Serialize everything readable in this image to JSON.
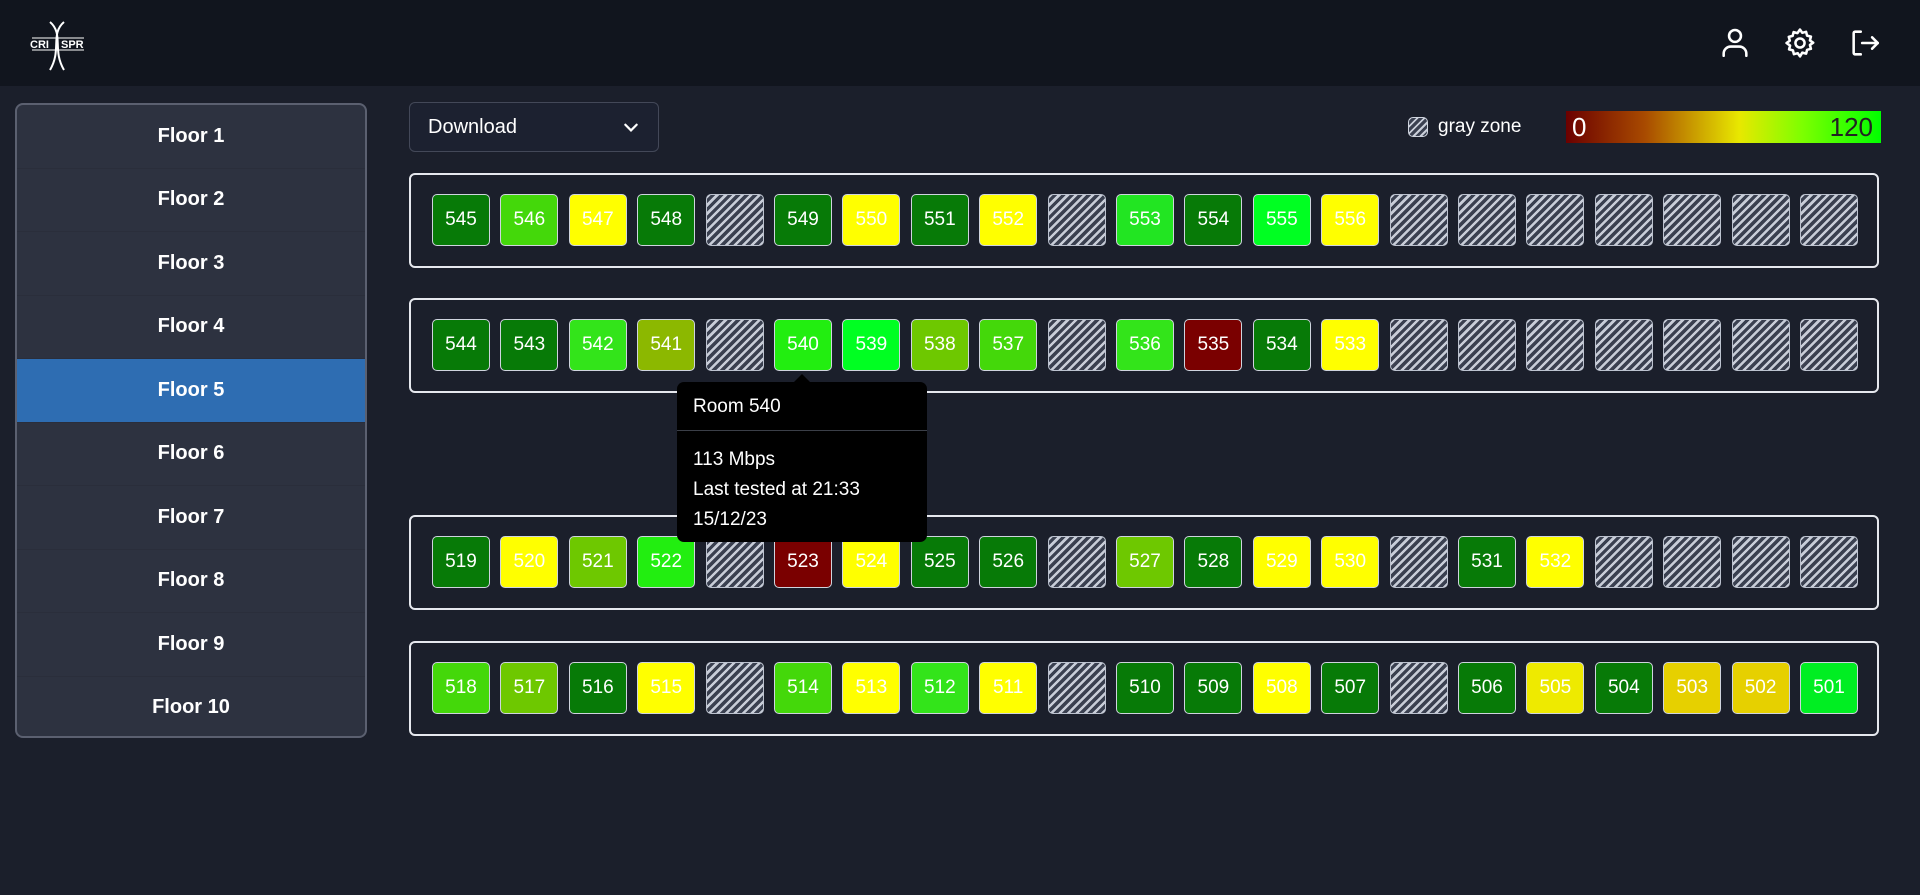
{
  "app": {
    "logo_text": "CRISPR"
  },
  "header": {
    "icons": [
      "user-icon",
      "gear-icon",
      "logout-icon"
    ]
  },
  "sidebar": {
    "items": [
      "Floor 1",
      "Floor 2",
      "Floor 3",
      "Floor 4",
      "Floor 5",
      "Floor 6",
      "Floor 7",
      "Floor 8",
      "Floor 9",
      "Floor 10"
    ],
    "active_index": 4
  },
  "toolbar": {
    "metric_selected": "Download"
  },
  "legend": {
    "gray_label": "gray zone",
    "scale_min": "0",
    "scale_max": "120"
  },
  "colors": {
    "accent": "#2e6db2",
    "scale_low": "#6b0000",
    "scale_high": "#00ff00"
  },
  "rows": [
    [
      {
        "label": "545",
        "color": "#077a07"
      },
      {
        "label": "546",
        "color": "#44d80a"
      },
      {
        "label": "547",
        "color": "#ffff00"
      },
      {
        "label": "548",
        "color": "#077a07"
      },
      {
        "label": "",
        "color": "gray"
      },
      {
        "label": "549",
        "color": "#077a07"
      },
      {
        "label": "550",
        "color": "#ffff00"
      },
      {
        "label": "551",
        "color": "#077a07"
      },
      {
        "label": "552",
        "color": "#ffff00"
      },
      {
        "label": "",
        "color": "gray"
      },
      {
        "label": "553",
        "color": "#22e522"
      },
      {
        "label": "554",
        "color": "#077a07"
      },
      {
        "label": "555",
        "color": "#00ff22"
      },
      {
        "label": "556",
        "color": "#ffff00"
      },
      {
        "label": "",
        "color": "gray"
      },
      {
        "label": "",
        "color": "gray"
      },
      {
        "label": "",
        "color": "gray"
      },
      {
        "label": "",
        "color": "gray"
      },
      {
        "label": "",
        "color": "gray"
      },
      {
        "label": "",
        "color": "gray"
      },
      {
        "label": "",
        "color": "gray"
      }
    ],
    [
      {
        "label": "544",
        "color": "#077a07"
      },
      {
        "label": "543",
        "color": "#077a07"
      },
      {
        "label": "542",
        "color": "#33e41a"
      },
      {
        "label": "541",
        "color": "#8cb800"
      },
      {
        "label": "",
        "color": "gray"
      },
      {
        "label": "540",
        "color": "#22ee10"
      },
      {
        "label": "539",
        "color": "#00ff22"
      },
      {
        "label": "538",
        "color": "#6ec800"
      },
      {
        "label": "537",
        "color": "#44d80a"
      },
      {
        "label": "",
        "color": "gray"
      },
      {
        "label": "536",
        "color": "#33e41a"
      },
      {
        "label": "535",
        "color": "#7a0000"
      },
      {
        "label": "534",
        "color": "#077a07"
      },
      {
        "label": "533",
        "color": "#ffff00"
      },
      {
        "label": "",
        "color": "gray"
      },
      {
        "label": "",
        "color": "gray"
      },
      {
        "label": "",
        "color": "gray"
      },
      {
        "label": "",
        "color": "gray"
      },
      {
        "label": "",
        "color": "gray"
      },
      {
        "label": "",
        "color": "gray"
      },
      {
        "label": "",
        "color": "gray"
      }
    ],
    [
      {
        "label": "519",
        "color": "#077a07"
      },
      {
        "label": "520",
        "color": "#ffff00"
      },
      {
        "label": "521",
        "color": "#6ec800"
      },
      {
        "label": "522",
        "color": "#22ee10"
      },
      {
        "label": "",
        "color": "gray"
      },
      {
        "label": "523",
        "color": "#7a0000"
      },
      {
        "label": "524",
        "color": "#ffff00"
      },
      {
        "label": "525",
        "color": "#077a07"
      },
      {
        "label": "526",
        "color": "#077a07"
      },
      {
        "label": "",
        "color": "gray"
      },
      {
        "label": "527",
        "color": "#6ec800"
      },
      {
        "label": "528",
        "color": "#077a07"
      },
      {
        "label": "529",
        "color": "#ffff00"
      },
      {
        "label": "530",
        "color": "#ffff00"
      },
      {
        "label": "",
        "color": "gray"
      },
      {
        "label": "531",
        "color": "#077a07"
      },
      {
        "label": "532",
        "color": "#ffff00"
      },
      {
        "label": "",
        "color": "gray"
      },
      {
        "label": "",
        "color": "gray"
      },
      {
        "label": "",
        "color": "gray"
      },
      {
        "label": "",
        "color": "gray"
      }
    ],
    [
      {
        "label": "518",
        "color": "#44d80a"
      },
      {
        "label": "517",
        "color": "#6ec800"
      },
      {
        "label": "516",
        "color": "#077a07"
      },
      {
        "label": "515",
        "color": "#ffff00"
      },
      {
        "label": "",
        "color": "gray"
      },
      {
        "label": "514",
        "color": "#44d80a"
      },
      {
        "label": "513",
        "color": "#ffff00"
      },
      {
        "label": "512",
        "color": "#33e41a"
      },
      {
        "label": "511",
        "color": "#ffff00"
      },
      {
        "label": "",
        "color": "gray"
      },
      {
        "label": "510",
        "color": "#077a07"
      },
      {
        "label": "509",
        "color": "#077a07"
      },
      {
        "label": "508",
        "color": "#ffff00"
      },
      {
        "label": "507",
        "color": "#077a07"
      },
      {
        "label": "",
        "color": "gray"
      },
      {
        "label": "506",
        "color": "#077a07"
      },
      {
        "label": "505",
        "color": "#eeea00"
      },
      {
        "label": "504",
        "color": "#077a07"
      },
      {
        "label": "503",
        "color": "#e6d000"
      },
      {
        "label": "502",
        "color": "#e6d000"
      },
      {
        "label": "501",
        "color": "#00ee22"
      }
    ]
  ],
  "tooltip": {
    "title": "Room 540",
    "speed": "113 Mbps",
    "tested": "Last tested at 21:33",
    "date": "15/12/23"
  }
}
